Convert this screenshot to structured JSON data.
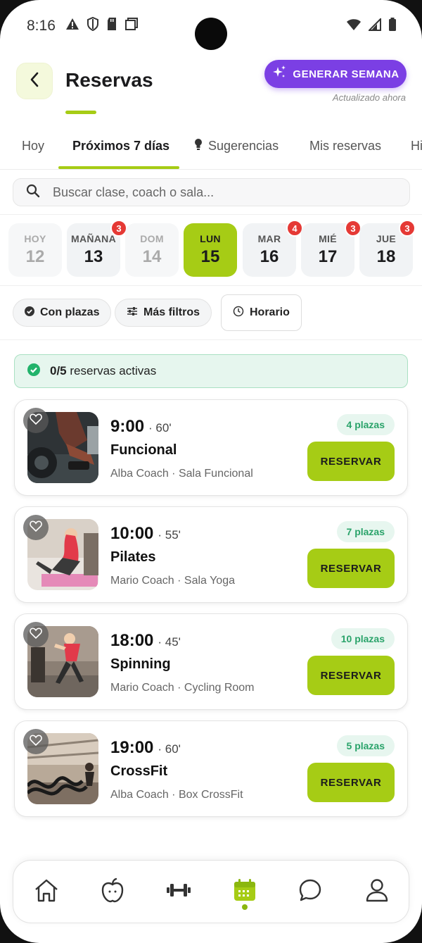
{
  "status_bar": {
    "time": "8:16"
  },
  "header": {
    "title": "Reservas",
    "generate_label": "GENERAR SEMANA",
    "updated_text": "Actualizado ahora"
  },
  "tabs": [
    {
      "label": "Hoy"
    },
    {
      "label": "Próximos 7 días",
      "active": true
    },
    {
      "label": "Sugerencias"
    },
    {
      "label": "Mis reservas"
    },
    {
      "label": "Hi"
    }
  ],
  "search": {
    "placeholder": "Buscar clase, coach o sala..."
  },
  "days": [
    {
      "name": "HOY",
      "date": "12",
      "state": "muted"
    },
    {
      "name": "MAÑANA",
      "date": "13",
      "badge": "3"
    },
    {
      "name": "DOM",
      "date": "14",
      "state": "muted"
    },
    {
      "name": "LUN",
      "date": "15",
      "state": "selected"
    },
    {
      "name": "MAR",
      "date": "16",
      "badge": "4"
    },
    {
      "name": "MIÉ",
      "date": "17",
      "badge": "3"
    },
    {
      "name": "JUE",
      "date": "18",
      "badge": "3"
    }
  ],
  "filters": {
    "with_spots": "Con plazas",
    "more_filters": "Más filtros",
    "schedule": "Horario"
  },
  "active_reservations": {
    "count": "0/5",
    "label": "reservas activas"
  },
  "classes": [
    {
      "time": "9:00",
      "duration": "· 60'",
      "name": "Funcional",
      "meta": "Alba Coach · Sala Funcional",
      "spots": "4 plazas",
      "cta": "RESERVAR"
    },
    {
      "time": "10:00",
      "duration": "· 55'",
      "name": "Pilates",
      "meta": "Mario Coach · Sala Yoga",
      "spots": "7 plazas",
      "cta": "RESERVAR"
    },
    {
      "time": "18:00",
      "duration": "· 45'",
      "name": "Spinning",
      "meta": "Mario Coach · Cycling Room",
      "spots": "10 plazas",
      "cta": "RESERVAR"
    },
    {
      "time": "19:00",
      "duration": "· 60'",
      "name": "CrossFit",
      "meta": "Alba Coach · Box CrossFit",
      "spots": "5 plazas",
      "cta": "RESERVAR"
    }
  ],
  "bottom_nav": [
    {
      "icon": "home-icon"
    },
    {
      "icon": "apple-icon"
    },
    {
      "icon": "dumbbell-icon"
    },
    {
      "icon": "calendar-icon",
      "active": true
    },
    {
      "icon": "chat-icon"
    },
    {
      "icon": "profile-icon"
    }
  ],
  "colors": {
    "accent": "#a6cc15",
    "primary_purple": "#7b3fe4",
    "badge_red": "#e53935",
    "success_green": "#2aa36a"
  }
}
